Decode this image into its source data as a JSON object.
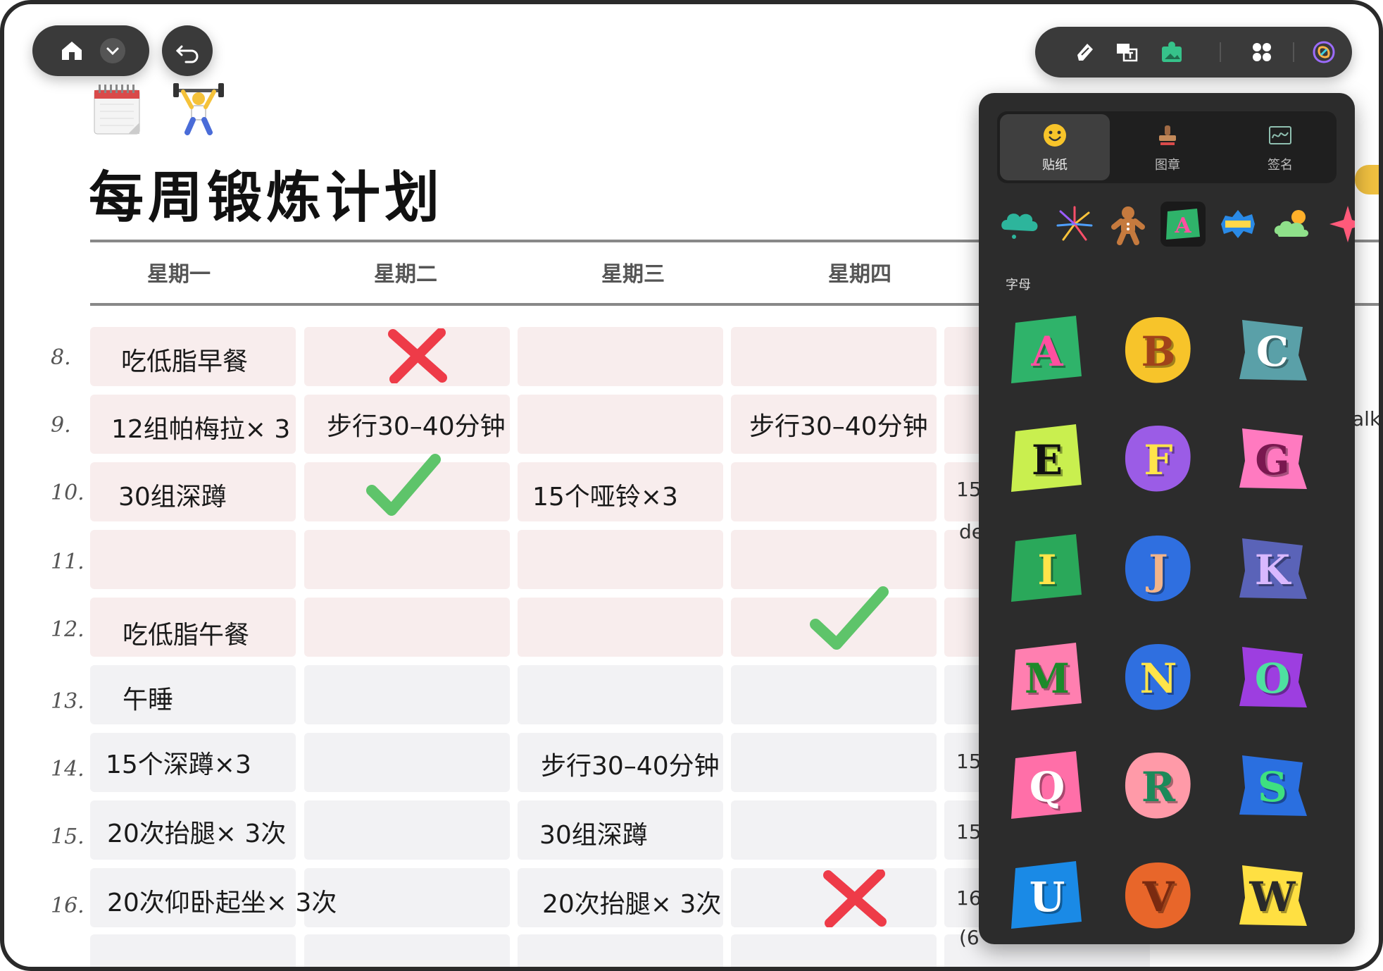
{
  "page": {
    "title": "每周锻炼计划",
    "days": [
      "星期一",
      "星期二",
      "星期三",
      "星期四"
    ],
    "rows": [
      {
        "num": "8.",
        "mon": "吃低脂早餐",
        "tue": "",
        "wed": "",
        "thu": ""
      },
      {
        "num": "9.",
        "mon": "12组帕梅拉× 3",
        "tue": "步行30–40分钟",
        "wed": "",
        "thu": "步行30–40分钟"
      },
      {
        "num": "10.",
        "mon": "30组深蹲",
        "tue": "",
        "wed": "15个哑铃×3",
        "thu": ""
      },
      {
        "num": "11.",
        "mon": "",
        "tue": "",
        "wed": "",
        "thu": ""
      },
      {
        "num": "12.",
        "mon": "吃低脂午餐",
        "tue": "",
        "wed": "",
        "thu": ""
      },
      {
        "num": "13.",
        "mon": "午睡",
        "tue": "",
        "wed": "",
        "thu": ""
      },
      {
        "num": "14.",
        "mon": "15个深蹲×3",
        "tue": "",
        "wed": "步行30–40分钟",
        "thu": ""
      },
      {
        "num": "15.",
        "mon": "20次抬腿× 3次",
        "tue": "",
        "wed": "30组深蹲",
        "thu": ""
      },
      {
        "num": "16.",
        "mon": "20次仰卧起坐× 3次",
        "tue": "",
        "wed": "20次抬腿× 3次",
        "thu": ""
      }
    ],
    "partial_text": {
      "r9": "alk",
      "r10a": "15",
      "r10b": "de",
      "r14": "15",
      "r15": "15",
      "r16a": "16",
      "r16b": "(6"
    }
  },
  "toolbar": {
    "left": [
      "home-icon",
      "chevron-down-icon"
    ],
    "undo": "undo-icon",
    "right": [
      "pen-tool-icon",
      "text-box-icon",
      "image-add-icon",
      "apps-grid-icon",
      "ai-assistant-icon"
    ]
  },
  "panel": {
    "tabs": [
      {
        "label": "贴纸",
        "icon": "smiley-sticker-icon",
        "active": true
      },
      {
        "label": "图章",
        "icon": "stamp-icon",
        "active": false
      },
      {
        "label": "签名",
        "icon": "signature-icon",
        "active": false
      }
    ],
    "categories": [
      "cloud-sticker-icon",
      "fireworks-sticker-icon",
      "gingerbread-sticker-icon",
      "letter-a-sticker-icon",
      "thanks-sticker-icon",
      "weather-sticker-icon",
      "sparkle-sticker-icon"
    ],
    "section_label": "字母",
    "stickers": [
      {
        "letter": "A",
        "bg": "#2fb36a",
        "fg": "#ff4fa0"
      },
      {
        "letter": "B",
        "bg": "#f7c42a",
        "fg": "#a0431a"
      },
      {
        "letter": "C",
        "bg": "#5aa0a8",
        "fg": "#ffffff"
      },
      {
        "letter": "E",
        "bg": "#c9ef4f",
        "fg": "#111111"
      },
      {
        "letter": "F",
        "bg": "#9b5ce6",
        "fg": "#ffe44a"
      },
      {
        "letter": "G",
        "bg": "#ff7ac0",
        "fg": "#7a1850"
      },
      {
        "letter": "I",
        "bg": "#2aa85a",
        "fg": "#ffe44a"
      },
      {
        "letter": "J",
        "bg": "#2f6fe0",
        "fg": "#f2b48a"
      },
      {
        "letter": "K",
        "bg": "#5a63b8",
        "fg": "#d9b8ff"
      },
      {
        "letter": "M",
        "bg": "#ff7fb0",
        "fg": "#1c8a2a"
      },
      {
        "letter": "N",
        "bg": "#2f6fe0",
        "fg": "#ffe44a"
      },
      {
        "letter": "O",
        "bg": "#9d3ee0",
        "fg": "#4ee0a0"
      },
      {
        "letter": "Q",
        "bg": "#ff6fa8",
        "fg": "#ffffff"
      },
      {
        "letter": "R",
        "bg": "#ff9aa8",
        "fg": "#1c8a5a"
      },
      {
        "letter": "S",
        "bg": "#2a6fe0",
        "fg": "#3ee080"
      },
      {
        "letter": "U",
        "bg": "#1a8ae6",
        "fg": "#ffffff"
      },
      {
        "letter": "V",
        "bg": "#e8662a",
        "fg": "#7a2a10"
      },
      {
        "letter": "W",
        "bg": "#ffe042",
        "fg": "#2a2a2a"
      }
    ]
  },
  "colors": {
    "accent_yellow": "#f0c040",
    "check_green": "#5ec46a",
    "cross_red": "#ee3b48"
  }
}
